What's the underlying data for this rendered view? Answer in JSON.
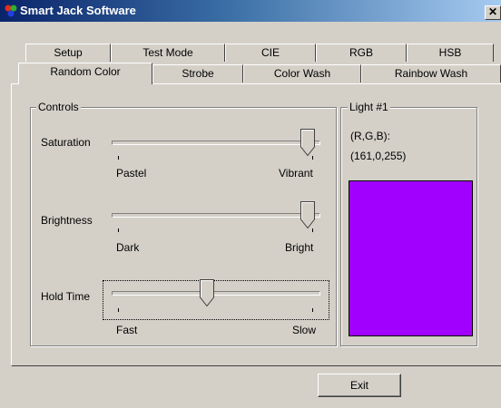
{
  "window": {
    "title": "Smart Jack Software",
    "close_glyph": "✕"
  },
  "tabs_back": [
    "Setup",
    "Test Mode",
    "CIE",
    "RGB",
    "HSB"
  ],
  "tabs_front": [
    "Random Color",
    "Strobe",
    "Color Wash",
    "Rainbow Wash"
  ],
  "active_tab": "Random Color",
  "controls": {
    "group_label": "Controls",
    "saturation": {
      "label": "Saturation",
      "min_label": "Pastel",
      "max_label": "Vibrant",
      "value_percent": 100
    },
    "brightness": {
      "label": "Brightness",
      "min_label": "Dark",
      "max_label": "Bright",
      "value_percent": 100
    },
    "hold_time": {
      "label": "Hold Time",
      "min_label": "Fast",
      "max_label": "Slow",
      "value_percent": 46
    }
  },
  "light": {
    "group_label": "Light #1",
    "rgb_label": "(R,G,B):",
    "rgb_value": "(161,0,255)",
    "swatch_color": "#a100ff"
  },
  "buttons": {
    "exit_label": "Exit"
  },
  "icons": {
    "app": "smart-jack-app-icon"
  }
}
